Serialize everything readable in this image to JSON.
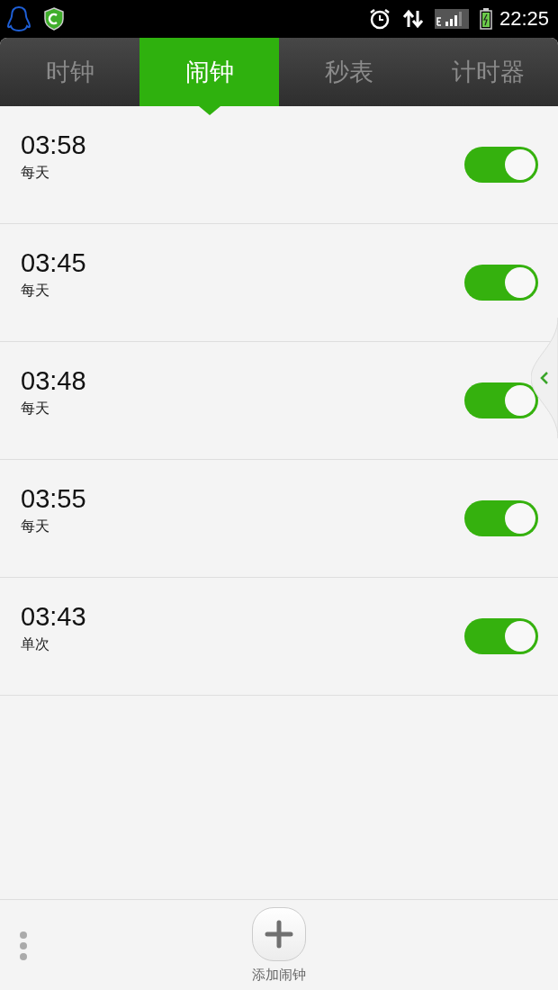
{
  "status_bar": {
    "time": "22:25"
  },
  "tabs": [
    {
      "label": "时钟",
      "selected": false
    },
    {
      "label": "闹钟",
      "selected": true
    },
    {
      "label": "秒表",
      "selected": false
    },
    {
      "label": "计时器",
      "selected": false
    }
  ],
  "alarms": [
    {
      "time": "03:58",
      "repeat": "每天",
      "on": true
    },
    {
      "time": "03:45",
      "repeat": "每天",
      "on": true
    },
    {
      "time": "03:48",
      "repeat": "每天",
      "on": true
    },
    {
      "time": "03:55",
      "repeat": "每天",
      "on": true
    },
    {
      "time": "03:43",
      "repeat": "单次",
      "on": true
    }
  ],
  "add_button": {
    "label": "添加闹钟"
  }
}
